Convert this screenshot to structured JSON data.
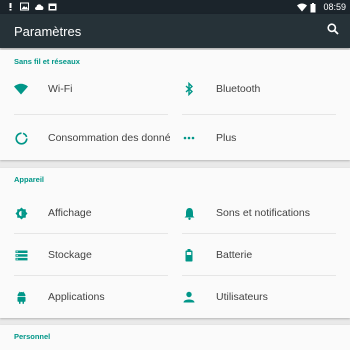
{
  "status_bar": {
    "time": "08:59",
    "left_icons": [
      "notification-icon",
      "image-icon",
      "cloud-download-icon",
      "calendar-icon"
    ],
    "right_icons": [
      "wifi-icon",
      "battery-icon"
    ]
  },
  "app_bar": {
    "title": "Paramètres",
    "search_icon": "search-icon"
  },
  "sections": {
    "wireless": {
      "header": "Sans fil et réseaux",
      "items": [
        {
          "label": "Wi-Fi",
          "icon": "wifi-icon"
        },
        {
          "label": "Bluetooth",
          "icon": "bluetooth-icon"
        },
        {
          "label": "Consommation des données",
          "icon": "data-usage-icon"
        },
        {
          "label": "Plus",
          "icon": "more-icon"
        }
      ]
    },
    "device": {
      "header": "Appareil",
      "items": [
        {
          "label": "Affichage",
          "icon": "brightness-icon"
        },
        {
          "label": "Sons et notifications",
          "icon": "bell-icon"
        },
        {
          "label": "Stockage",
          "icon": "storage-icon"
        },
        {
          "label": "Batterie",
          "icon": "battery-icon"
        },
        {
          "label": "Applications",
          "icon": "android-icon"
        },
        {
          "label": "Utilisateurs",
          "icon": "person-icon"
        }
      ]
    },
    "personal": {
      "header": "Personnel"
    }
  },
  "colors": {
    "accent": "#009688",
    "app_bar": "#263238",
    "status_bar": "#1b242b",
    "card": "#fafafa",
    "icon": "#009688"
  }
}
